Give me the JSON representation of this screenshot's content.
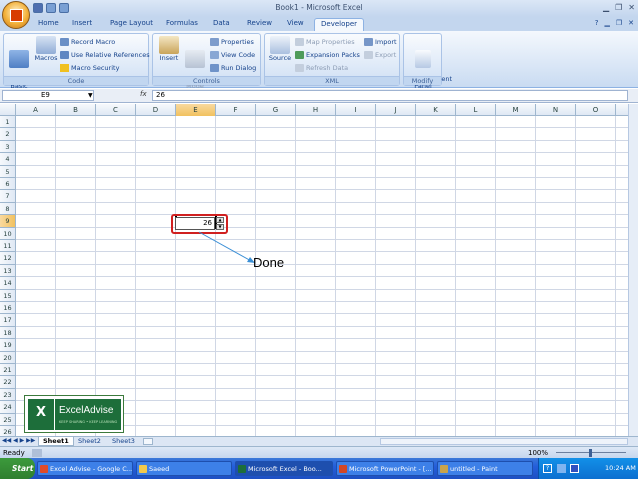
{
  "window": {
    "title": "Book1 - Microsoft Excel"
  },
  "ribbon_tabs": [
    "Home",
    "Insert",
    "Page Layout",
    "Formulas",
    "Data",
    "Review",
    "View",
    "Developer"
  ],
  "active_tab": "Developer",
  "groups": {
    "code": {
      "title": "Code",
      "visual_basic": "Visual\nBasic",
      "macros": "Macros",
      "record_macro": "Record Macro",
      "use_relative": "Use Relative References",
      "macro_security": "Macro Security"
    },
    "controls": {
      "title": "Controls",
      "insert": "Insert",
      "design_mode": "Design\nMode",
      "properties": "Properties",
      "view_code": "View Code",
      "run_dialog": "Run Dialog"
    },
    "xml": {
      "title": "XML",
      "source": "Source",
      "map_properties": "Map Properties",
      "expansion_packs": "Expansion Packs",
      "refresh_data": "Refresh Data",
      "import": "Import",
      "export": "Export"
    },
    "modify": {
      "title": "Modify",
      "document_panel": "Document\nPanel"
    }
  },
  "formula_bar": {
    "name_box": "E9",
    "fx": "fx",
    "value": "26"
  },
  "columns": [
    "A",
    "B",
    "C",
    "D",
    "E",
    "F",
    "G",
    "H",
    "I",
    "J",
    "K",
    "L",
    "M",
    "N",
    "O"
  ],
  "rows": [
    "1",
    "2",
    "3",
    "4",
    "5",
    "6",
    "7",
    "8",
    "9",
    "10",
    "11",
    "12",
    "13",
    "14",
    "15",
    "16",
    "17",
    "18",
    "19",
    "20",
    "21",
    "22",
    "23",
    "24",
    "25",
    "26"
  ],
  "selected_cell": {
    "col": "E",
    "row": "9",
    "value": "26"
  },
  "spinner": {
    "value": "26"
  },
  "callout": {
    "text": "Done"
  },
  "watermark": {
    "name": "ExcelAdvise",
    "tagline": "KEEP SHARING • KEEP LEARNING"
  },
  "sheets": [
    "Sheet1",
    "Sheet2",
    "Sheet3"
  ],
  "active_sheet": "Sheet1",
  "status": {
    "left": "Ready",
    "zoom": "100%"
  },
  "taskbar": {
    "start": "Start",
    "items": [
      "Excel Advise - Google C...",
      "Saeed",
      "Microsoft Excel - Boo...",
      "Microsoft PowerPoint - [...",
      "untitled - Paint"
    ],
    "active_item": "Microsoft Excel - Boo...",
    "clock": "10:24 AM"
  },
  "colors": {
    "accent": "#15428b",
    "selection": "#f1c15f",
    "highlight_ring": "#d02020",
    "arrow": "#3a8fd6"
  }
}
